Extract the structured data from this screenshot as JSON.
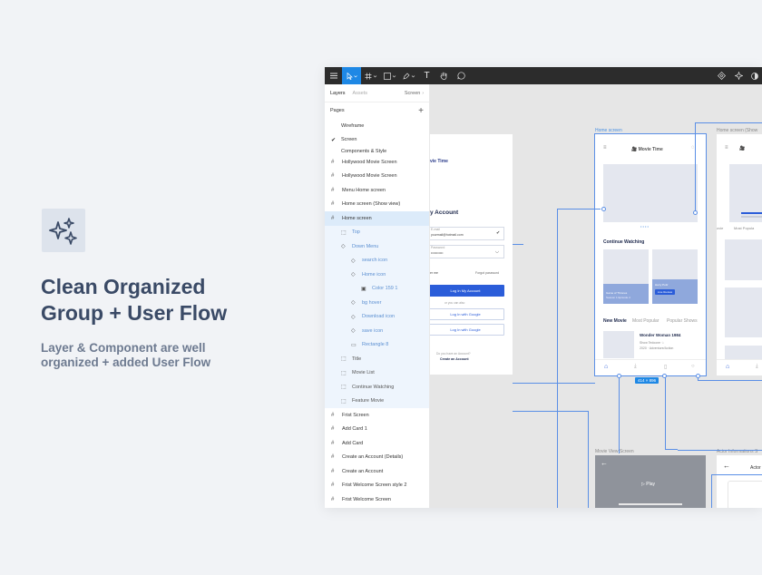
{
  "promo": {
    "headline_line1": "Clean Organized",
    "headline_line2": "Group + User Flow",
    "sub_line1": "Layer & Component are well",
    "sub_line2": "organized + added User Flow",
    "accent": "#3a4a66",
    "icon": "sparkles-icon"
  },
  "toolbar": {
    "icons": [
      "hamburger-icon",
      "move-tool-icon",
      "frame-tool-icon",
      "shape-tool-icon",
      "pen-tool-icon",
      "text-tool-icon",
      "hand-tool-icon",
      "comment-tool-icon"
    ],
    "text_glyph": "T",
    "active_color": "#1e88e5"
  },
  "panel": {
    "tab_layers": "Layers",
    "tab_assets": "Assets",
    "page_select": "Screen",
    "pages_label": "Pages",
    "pages": [
      "Wireframe",
      "Screen",
      "Components & Style"
    ],
    "current_page": "Screen",
    "layers": [
      {
        "label": "Hollywood Movie Screen",
        "kind": "frame"
      },
      {
        "label": "Hollywood Movie Screen",
        "kind": "frame"
      },
      {
        "label": "Menu Home screen",
        "kind": "frame"
      },
      {
        "label": "Home screen (Show view)",
        "kind": "frame"
      },
      {
        "label": "Home screen",
        "kind": "frame",
        "selected": true
      },
      {
        "label": "Top",
        "kind": "group",
        "depth": 1
      },
      {
        "label": "Down Menu",
        "kind": "component",
        "depth": 1
      },
      {
        "label": "search icon",
        "kind": "component",
        "depth": 2
      },
      {
        "label": "Home icon",
        "kind": "component",
        "depth": 2
      },
      {
        "label": "Color 159 1",
        "kind": "image",
        "depth": 3
      },
      {
        "label": "bg hover",
        "kind": "component",
        "depth": 2
      },
      {
        "label": "Download icon",
        "kind": "component",
        "depth": 2
      },
      {
        "label": "save icon",
        "kind": "component",
        "depth": 2
      },
      {
        "label": "Rectangle 8",
        "kind": "rect",
        "depth": 2
      },
      {
        "label": "Title",
        "kind": "group",
        "depth": 1
      },
      {
        "label": "Movie List",
        "kind": "group",
        "depth": 1
      },
      {
        "label": "Continue Watching",
        "kind": "group",
        "depth": 1
      },
      {
        "label": "Feature Movie",
        "kind": "group",
        "depth": 1
      },
      {
        "label": "Frist Screen",
        "kind": "frame"
      },
      {
        "label": "Add Card 1",
        "kind": "frame"
      },
      {
        "label": "Add Card",
        "kind": "frame"
      },
      {
        "label": "Create an Account (Details)",
        "kind": "frame"
      },
      {
        "label": "Create an Account",
        "kind": "frame"
      },
      {
        "label": "Frist Welcome Screen style 2",
        "kind": "frame"
      },
      {
        "label": "Frist Welcome Screen",
        "kind": "frame"
      }
    ]
  },
  "canvas": {
    "login": {
      "app_title": "vie Time",
      "heading": "y Account",
      "email_label": "E-mail",
      "email_value": "yourmail@hotmail.com",
      "password_label": "Password",
      "password_value": "•••••••••••",
      "remember": "er me",
      "forgot": "Forgot password",
      "login_button": "Log In My Account",
      "or_text": "or you can also",
      "google_button_1": "Log In with Google",
      "google_button_2": "Log In with Google",
      "no_account": "Do you have an Account?",
      "create_account": "Create an Account"
    },
    "home": {
      "frame_label": "Home screen",
      "app_title": "Movie Time",
      "continue_watching": "Continue Watching",
      "card_title": "Game of Thrones",
      "card_meta": "Season 1 Episode 4",
      "card_meta_2": "Harry Pottr",
      "card_button": "Live Review",
      "tab_new": "New Movie",
      "tab_popular": "Most Popular",
      "tab_shows": "Popular Shows",
      "movie_title": "Wonder Woman 1984",
      "movie_meta": "Show Tedoone ☆",
      "movie_meta_2": "2020 · Adventure/Action",
      "size_label": "414 × 896"
    },
    "home_show": {
      "frame_label": "Home screen (Show",
      "tab_1": "ovie",
      "tab_2": "Most Popula"
    },
    "movie_view": {
      "frame_label": "Movie View Screen",
      "play_label": "Play"
    },
    "actor": {
      "frame_label": "Actor Informations S",
      "title": "Actor"
    },
    "flow_color": "#5a8fe6"
  }
}
